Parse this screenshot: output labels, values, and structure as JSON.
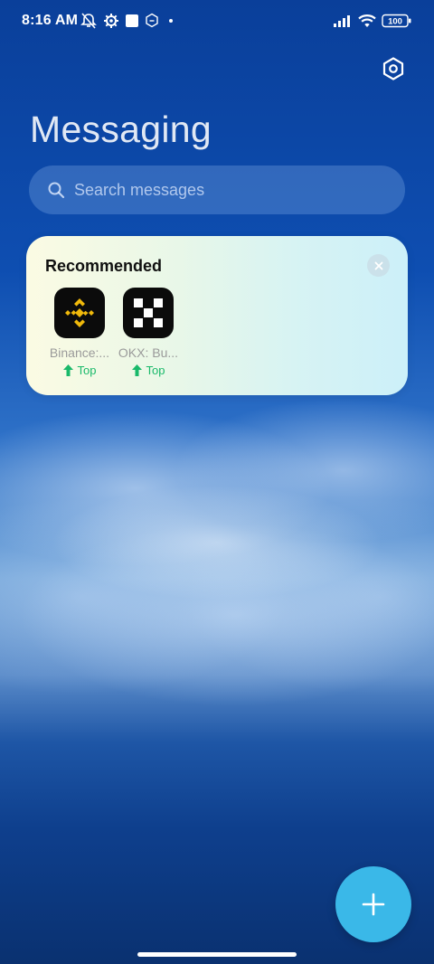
{
  "status_bar": {
    "time": "8:16 AM",
    "battery": "100",
    "left_icons": [
      "notifications-off-icon",
      "settings-gear-icon",
      "square-app-icon",
      "hexagon-app-icon",
      "dot-icon"
    ],
    "right_icons": [
      "signal-icon",
      "wifi-icon",
      "battery-icon"
    ]
  },
  "header": {
    "title": "Messaging",
    "settings_icon": "hexagon-settings-icon"
  },
  "search": {
    "placeholder": "Search messages"
  },
  "recommended": {
    "title": "Recommended",
    "apps": [
      {
        "name": "Binance:...",
        "badge": "Top",
        "icon": "binance-logo-icon",
        "icon_color": "#f0b90b"
      },
      {
        "name": "OKX: Bu...",
        "badge": "Top",
        "icon": "okx-logo-icon",
        "icon_color": "#ffffff"
      }
    ]
  },
  "fab": {
    "icon": "plus-icon",
    "color": "#3ab8e8"
  },
  "colors": {
    "accent_green": "#19b96a",
    "background_top": "#0a3f9a"
  }
}
